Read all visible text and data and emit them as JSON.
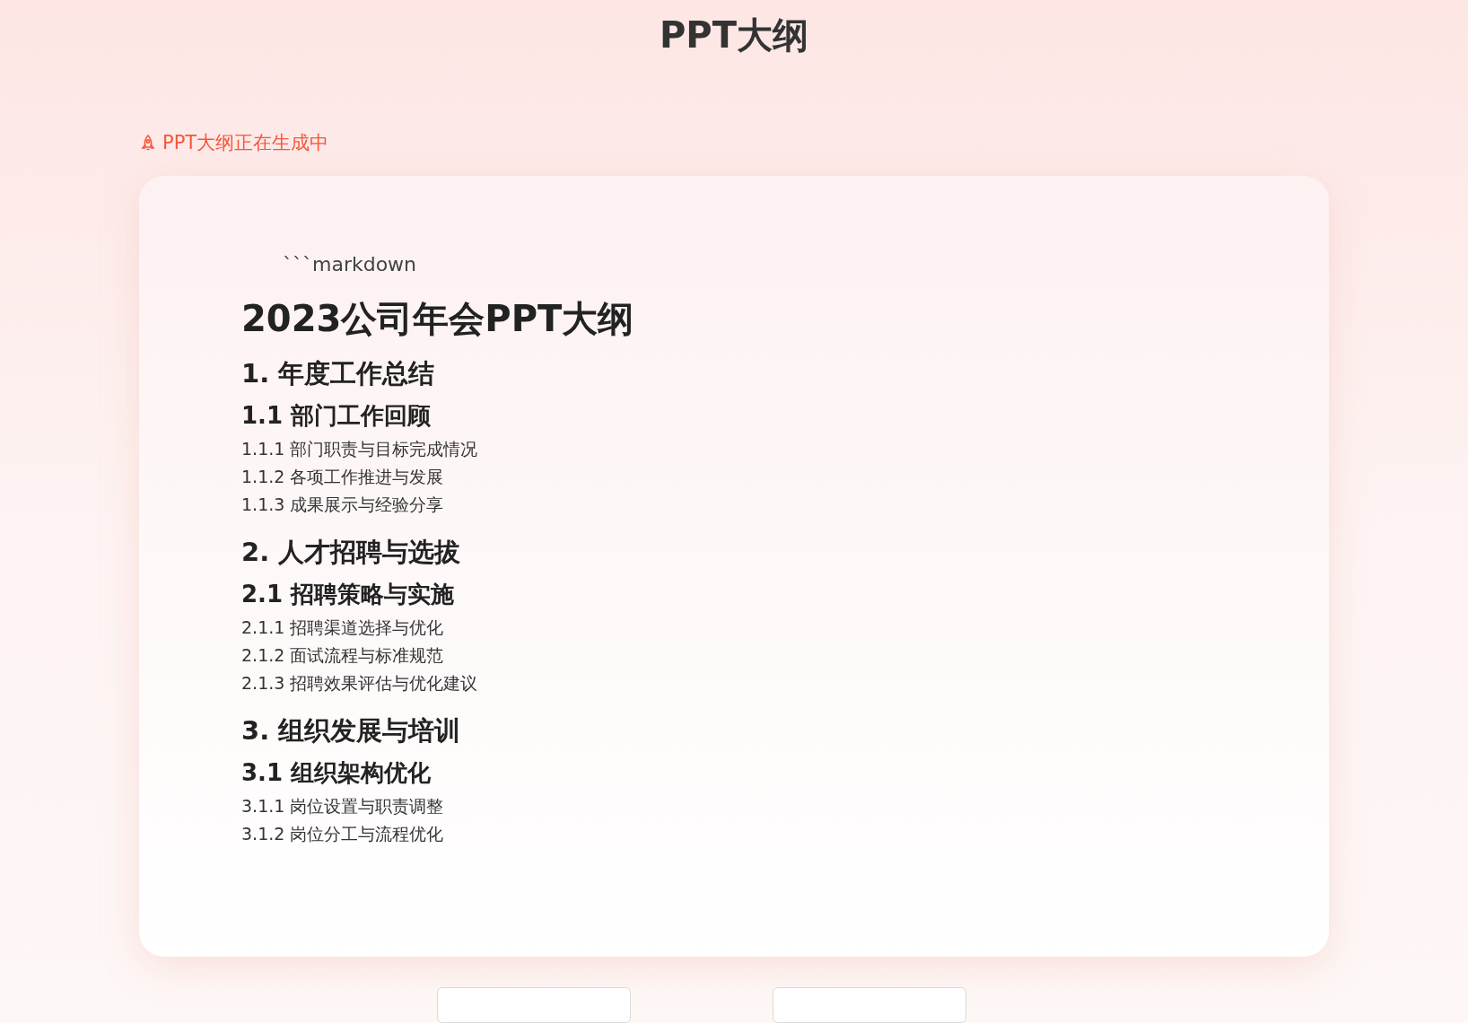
{
  "page_title": "PPT大纲",
  "status": {
    "text": "PPT大纲正在生成中"
  },
  "outline": {
    "code_fence": "```markdown",
    "title": "2023公司年会PPT大纲",
    "sections": [
      {
        "heading": "1. 年度工作总结",
        "children": [
          {
            "heading": "1.1 部门工作回顾",
            "children": [
              "1.1.1 部门职责与目标完成情况",
              "1.1.2 各项工作推进与发展",
              "1.1.3 成果展示与经验分享"
            ]
          }
        ]
      },
      {
        "heading": "2. 人才招聘与选拔",
        "children": [
          {
            "heading": "2.1 招聘策略与实施",
            "children": [
              "2.1.1 招聘渠道选择与优化",
              "2.1.2 面试流程与标准规范",
              "2.1.3 招聘效果评估与优化建议"
            ]
          }
        ]
      },
      {
        "heading": "3. 组织发展与培训",
        "children": [
          {
            "heading": "3.1 组织架构优化",
            "children": [
              "3.1.1 岗位设置与职责调整",
              "3.1.2 岗位分工与流程优化"
            ]
          }
        ]
      }
    ]
  }
}
